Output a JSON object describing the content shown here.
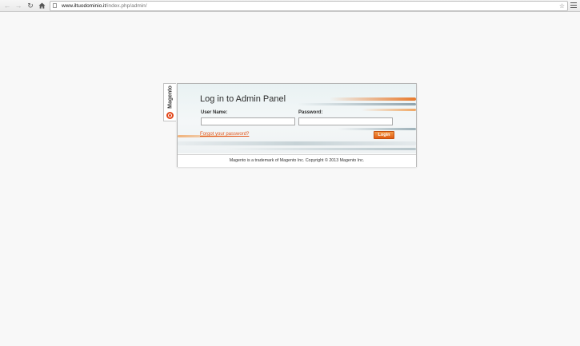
{
  "browser": {
    "back_icon": "arrow-left-icon",
    "forward_icon": "arrow-right-icon",
    "reload_icon": "reload-icon",
    "home_icon": "home-icon",
    "url_host": "www.iltuodominio.it",
    "url_path": "/index.php/admin/",
    "bookmark_icon": "star-icon",
    "menu_icon": "hamburger-menu-icon"
  },
  "side_tab": {
    "brand": "Magento",
    "logo_icon": "magento-logo-icon",
    "logo_color": "#e2481c"
  },
  "login": {
    "title": "Log in to Admin Panel",
    "username_label": "User Name:",
    "username_value": "",
    "password_label": "Password:",
    "password_value": "",
    "forgot_link": "Forgot your password?",
    "login_button": "Login",
    "footer": "Magento is a trademark of Magento Inc. Copyright © 2013 Magento Inc."
  },
  "colors": {
    "accent_orange": "#e2561b",
    "button_orange": "#e86a1c",
    "page_background": "#f8f8f8"
  }
}
